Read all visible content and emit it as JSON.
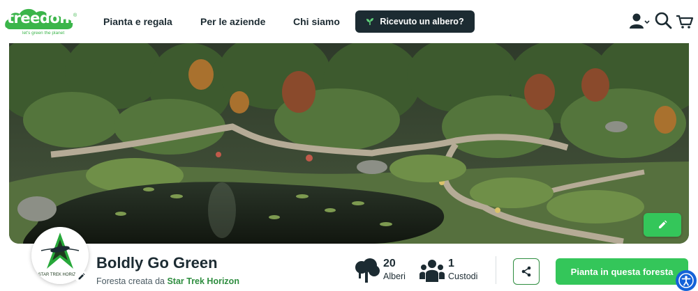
{
  "header": {
    "logo_text": "treedom",
    "logo_tagline": "let's green the planet",
    "logo_mark": "®",
    "nav": [
      {
        "label": "Pianta e regala"
      },
      {
        "label": "Per le aziende"
      },
      {
        "label": "Chi siamo"
      }
    ],
    "gift_button_label": "Ricevuto un albero?",
    "icons": [
      "user-icon",
      "search-icon",
      "cart-icon"
    ]
  },
  "hero": {
    "image": "forest-garden-pond-photo",
    "edit_icon": "pencil-icon"
  },
  "forest": {
    "avatar_text": "STAR TREK HORIZON",
    "title": "Boldly Go Green",
    "subtitle_prefix": "Foresta creata da",
    "creator": "Star Trek Horizon"
  },
  "stats": {
    "trees_count": "20",
    "trees_label": "Alberi",
    "custodians_count": "1",
    "custodians_label": "Custodi"
  },
  "actions": {
    "share_icon": "share-icon",
    "plant_label": "Pianta in questa foresta",
    "accessibility_icon": "accessibility-icon"
  },
  "colors": {
    "brand_green": "#34c65a",
    "dark": "#1c2b32",
    "link_green": "#2e8d3f",
    "accessibility_blue": "#1462d8"
  }
}
